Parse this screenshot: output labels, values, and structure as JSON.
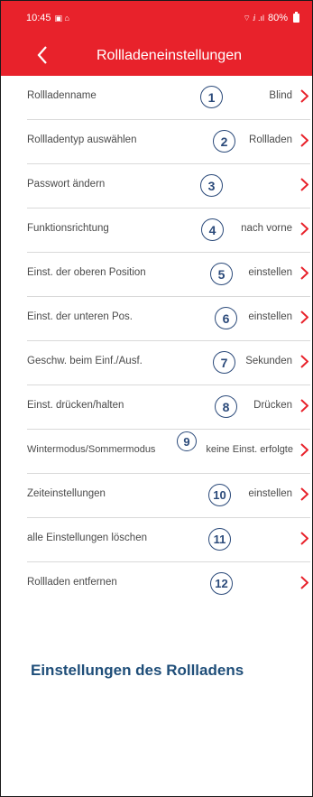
{
  "status_bar": {
    "time": "10:45",
    "status_icons": "▣ ⌂",
    "network": "⌔ ⅈ .ıl",
    "battery": "80%"
  },
  "header": {
    "title": "Rollladeneinstellungen"
  },
  "settings": [
    {
      "label": "Rollladenname",
      "value": "Blind",
      "callout": "1"
    },
    {
      "label": "Rollladentyp auswählen",
      "value": "Rollladen",
      "callout": "2"
    },
    {
      "label": "Passwort ändern",
      "value": "",
      "callout": "3"
    },
    {
      "label": "Funktionsrichtung",
      "value": "nach vorne",
      "callout": "4"
    },
    {
      "label": "Einst. der oberen Position",
      "value": "einstellen",
      "callout": "5"
    },
    {
      "label": "Einst. der unteren Pos.",
      "value": "einstellen",
      "callout": "6"
    },
    {
      "label": "Geschw. beim Einf./Ausf.",
      "value": "Sekunden",
      "callout": "7"
    },
    {
      "label": "Einst. drücken/halten",
      "value": "Drücken",
      "callout": "8"
    },
    {
      "label": "Wintermodus/Sommermodus",
      "value": "keine Einst. erfolgte",
      "callout": "9"
    },
    {
      "label": "Zeiteinstellungen",
      "value": "einstellen",
      "callout": "10"
    },
    {
      "label": "alle Einstellungen löschen",
      "value": "",
      "callout": "11"
    },
    {
      "label": "Rollladen entfernen",
      "value": "",
      "callout": "12"
    }
  ],
  "caption": "Einstellungen des Rollladens",
  "colors": {
    "accent": "#e8222b",
    "callout": "#2b4a7a",
    "caption": "#1f4e79"
  }
}
